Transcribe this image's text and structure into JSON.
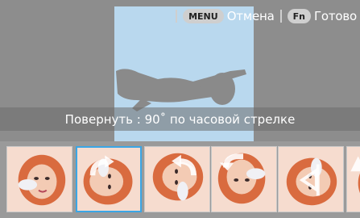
{
  "topbar": {
    "menu_key": "MENU",
    "cancel_label": "Отмена",
    "fn_key": "Fn",
    "done_label": "Готово"
  },
  "caption": {
    "text": "Повернуть : 90˚ по часовой стрелке"
  },
  "thumbnails": [
    {
      "name": "original",
      "selected": false
    },
    {
      "name": "rotate-90-cw",
      "selected": true
    },
    {
      "name": "rotate-90-ccw",
      "selected": false
    },
    {
      "name": "rotate-180",
      "selected": false
    },
    {
      "name": "flip-horizontal",
      "selected": false
    },
    {
      "name": "flip-vertical",
      "selected": false
    }
  ],
  "colors": {
    "background": "#8d8d8d",
    "preview_band": "#b9d8ee",
    "selection_border": "#3aa6e6"
  }
}
